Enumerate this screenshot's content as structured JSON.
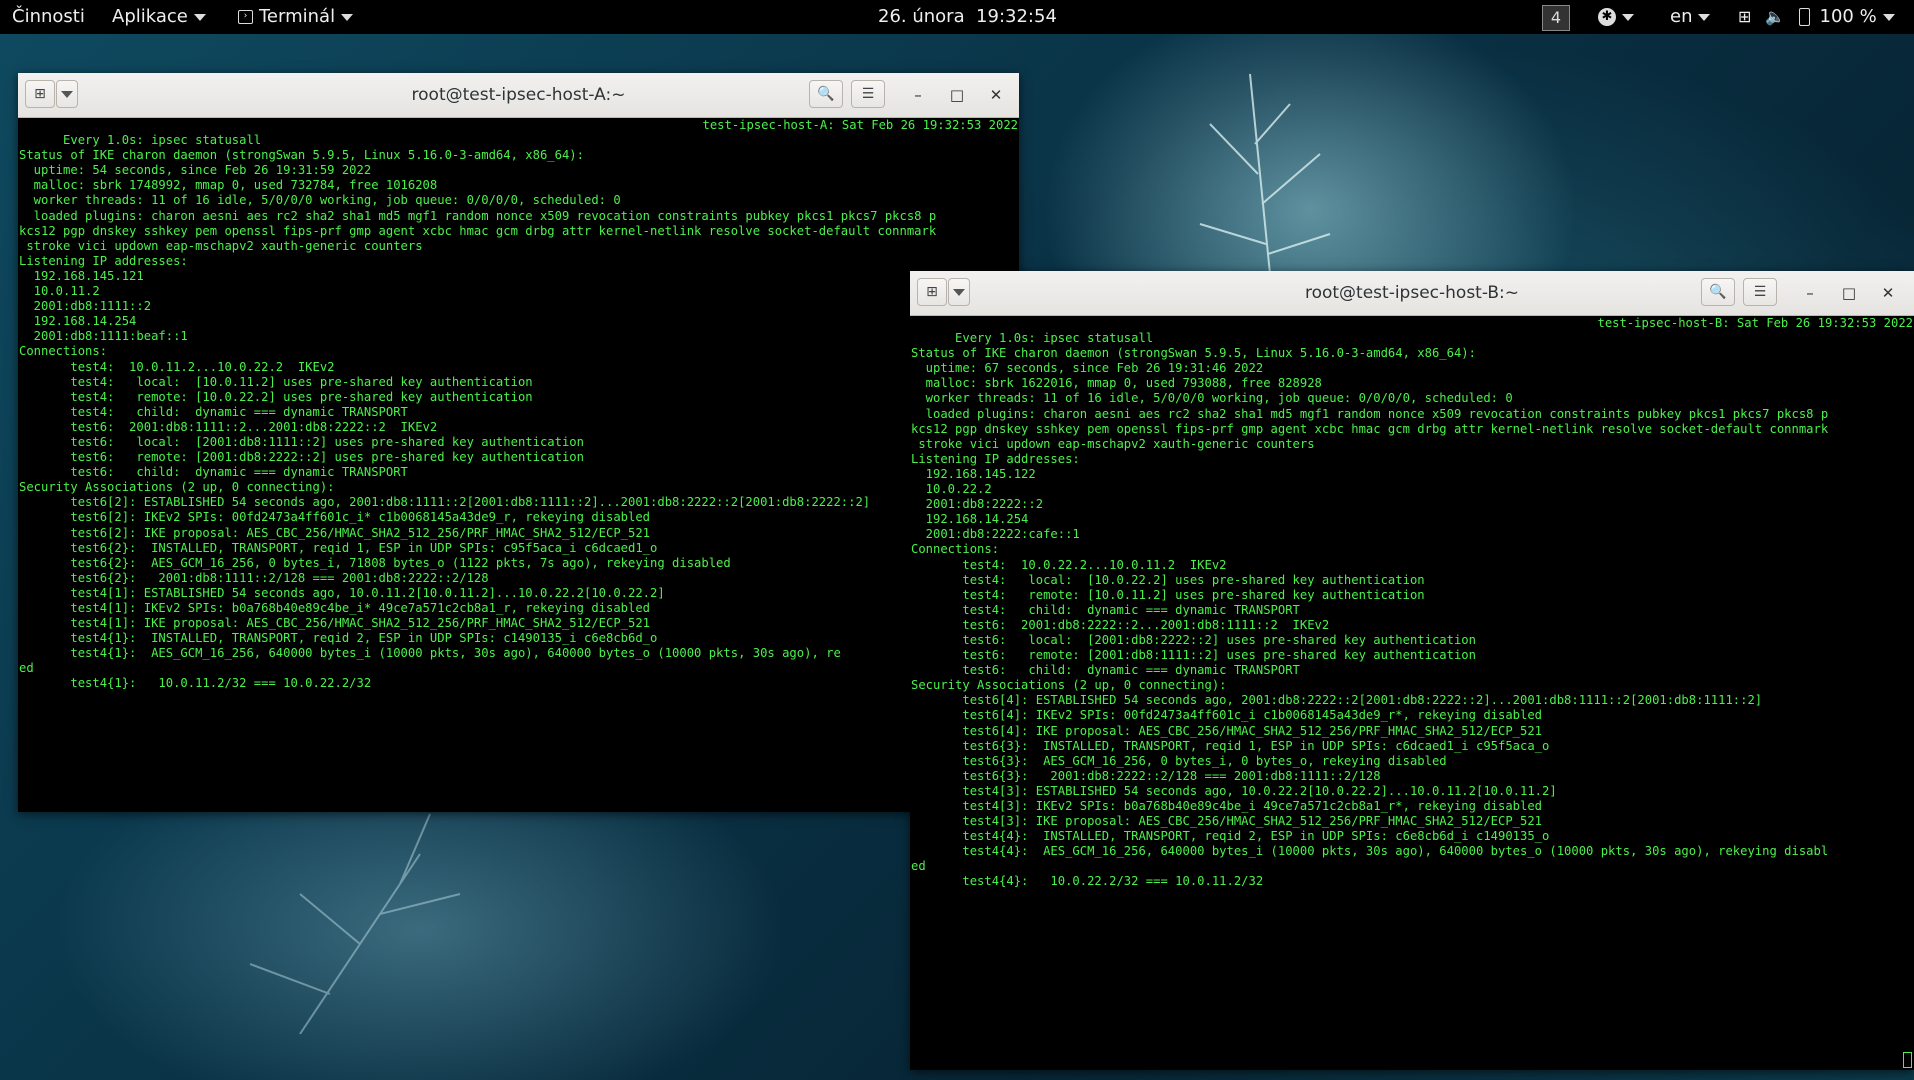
{
  "topbar": {
    "activities": "Činnosti",
    "applications": "Aplikace",
    "app_menu": "Terminál",
    "clock": "26. února  19:32:54",
    "workspace": "4",
    "language": "en",
    "battery": "100 %"
  },
  "colors": {
    "terminal_text": "#4cf04c",
    "terminal_bg": "#000000",
    "titlebar_bg": "#efeeec"
  },
  "window_a": {
    "title": "root@test-ipsec-host-A:~",
    "header_left": "Every 1.0s: ipsec statusall",
    "header_right": "test-ipsec-host-A: Sat Feb 26 19:32:53 2022",
    "lines": [
      "",
      "Status of IKE charon daemon (strongSwan 5.9.5, Linux 5.16.0-3-amd64, x86_64):",
      "  uptime: 54 seconds, since Feb 26 19:31:59 2022",
      "  malloc: sbrk 1748992, mmap 0, used 732784, free 1016208",
      "  worker threads: 11 of 16 idle, 5/0/0/0 working, job queue: 0/0/0/0, scheduled: 0",
      "  loaded plugins: charon aesni aes rc2 sha2 sha1 md5 mgf1 random nonce x509 revocation constraints pubkey pkcs1 pkcs7 pkcs8 p",
      "kcs12 pgp dnskey sshkey pem openssl fips-prf gmp agent xcbc hmac gcm drbg attr kernel-netlink resolve socket-default connmark",
      " stroke vici updown eap-mschapv2 xauth-generic counters",
      "Listening IP addresses:",
      "  192.168.145.121",
      "  10.0.11.2",
      "  2001:db8:1111::2",
      "  192.168.14.254",
      "  2001:db8:1111:beaf::1",
      "Connections:",
      "       test4:  10.0.11.2...10.0.22.2  IKEv2",
      "       test4:   local:  [10.0.11.2] uses pre-shared key authentication",
      "       test4:   remote: [10.0.22.2] uses pre-shared key authentication",
      "       test4:   child:  dynamic === dynamic TRANSPORT",
      "       test6:  2001:db8:1111::2...2001:db8:2222::2  IKEv2",
      "       test6:   local:  [2001:db8:1111::2] uses pre-shared key authentication",
      "       test6:   remote: [2001:db8:2222::2] uses pre-shared key authentication",
      "       test6:   child:  dynamic === dynamic TRANSPORT",
      "Security Associations (2 up, 0 connecting):",
      "       test6[2]: ESTABLISHED 54 seconds ago, 2001:db8:1111::2[2001:db8:1111::2]...2001:db8:2222::2[2001:db8:2222::2]",
      "       test6[2]: IKEv2 SPIs: 00fd2473a4ff601c_i* c1b0068145a43de9_r, rekeying disabled",
      "       test6[2]: IKE proposal: AES_CBC_256/HMAC_SHA2_512_256/PRF_HMAC_SHA2_512/ECP_521",
      "       test6{2}:  INSTALLED, TRANSPORT, reqid 1, ESP in UDP SPIs: c95f5aca_i c6dcaed1_o",
      "       test6{2}:  AES_GCM_16_256, 0 bytes_i, 71808 bytes_o (1122 pkts, 7s ago), rekeying disabled",
      "       test6{2}:   2001:db8:1111::2/128 === 2001:db8:2222::2/128",
      "       test4[1]: ESTABLISHED 54 seconds ago, 10.0.11.2[10.0.11.2]...10.0.22.2[10.0.22.2]",
      "       test4[1]: IKEv2 SPIs: b0a768b40e89c4be_i* 49ce7a571c2cb8a1_r, rekeying disabled",
      "       test4[1]: IKE proposal: AES_CBC_256/HMAC_SHA2_512_256/PRF_HMAC_SHA2_512/ECP_521",
      "       test4{1}:  INSTALLED, TRANSPORT, reqid 2, ESP in UDP SPIs: c1490135_i c6e8cb6d_o",
      "       test4{1}:  AES_GCM_16_256, 640000 bytes_i (10000 pkts, 30s ago), 640000 bytes_o (10000 pkts, 30s ago), re",
      "ed",
      "       test4{1}:   10.0.11.2/32 === 10.0.22.2/32"
    ]
  },
  "window_b": {
    "title": "root@test-ipsec-host-B:~",
    "header_left": "Every 1.0s: ipsec statusall",
    "header_right": "test-ipsec-host-B: Sat Feb 26 19:32:53 2022",
    "lines": [
      "",
      "Status of IKE charon daemon (strongSwan 5.9.5, Linux 5.16.0-3-amd64, x86_64):",
      "  uptime: 67 seconds, since Feb 26 19:31:46 2022",
      "  malloc: sbrk 1622016, mmap 0, used 793088, free 828928",
      "  worker threads: 11 of 16 idle, 5/0/0/0 working, job queue: 0/0/0/0, scheduled: 0",
      "  loaded plugins: charon aesni aes rc2 sha2 sha1 md5 mgf1 random nonce x509 revocation constraints pubkey pkcs1 pkcs7 pkcs8 p",
      "kcs12 pgp dnskey sshkey pem openssl fips-prf gmp agent xcbc hmac gcm drbg attr kernel-netlink resolve socket-default connmark",
      " stroke vici updown eap-mschapv2 xauth-generic counters",
      "Listening IP addresses:",
      "  192.168.145.122",
      "  10.0.22.2",
      "  2001:db8:2222::2",
      "  192.168.14.254",
      "  2001:db8:2222:cafe::1",
      "Connections:",
      "       test4:  10.0.22.2...10.0.11.2  IKEv2",
      "       test4:   local:  [10.0.22.2] uses pre-shared key authentication",
      "       test4:   remote: [10.0.11.2] uses pre-shared key authentication",
      "       test4:   child:  dynamic === dynamic TRANSPORT",
      "       test6:  2001:db8:2222::2...2001:db8:1111::2  IKEv2",
      "       test6:   local:  [2001:db8:2222::2] uses pre-shared key authentication",
      "       test6:   remote: [2001:db8:1111::2] uses pre-shared key authentication",
      "       test6:   child:  dynamic === dynamic TRANSPORT",
      "Security Associations (2 up, 0 connecting):",
      "       test6[4]: ESTABLISHED 54 seconds ago, 2001:db8:2222::2[2001:db8:2222::2]...2001:db8:1111::2[2001:db8:1111::2]",
      "       test6[4]: IKEv2 SPIs: 00fd2473a4ff601c_i c1b0068145a43de9_r*, rekeying disabled",
      "       test6[4]: IKE proposal: AES_CBC_256/HMAC_SHA2_512_256/PRF_HMAC_SHA2_512/ECP_521",
      "       test6{3}:  INSTALLED, TRANSPORT, reqid 1, ESP in UDP SPIs: c6dcaed1_i c95f5aca_o",
      "       test6{3}:  AES_GCM_16_256, 0 bytes_i, 0 bytes_o, rekeying disabled",
      "       test6{3}:   2001:db8:2222::2/128 === 2001:db8:1111::2/128",
      "       test4[3]: ESTABLISHED 54 seconds ago, 10.0.22.2[10.0.22.2]...10.0.11.2[10.0.11.2]",
      "       test4[3]: IKEv2 SPIs: b0a768b40e89c4be_i 49ce7a571c2cb8a1_r*, rekeying disabled",
      "       test4[3]: IKE proposal: AES_CBC_256/HMAC_SHA2_512_256/PRF_HMAC_SHA2_512/ECP_521",
      "       test4{4}:  INSTALLED, TRANSPORT, reqid 2, ESP in UDP SPIs: c6e8cb6d_i c1490135_o",
      "       test4{4}:  AES_GCM_16_256, 640000 bytes_i (10000 pkts, 30s ago), 640000 bytes_o (10000 pkts, 30s ago), rekeying disabl",
      "ed",
      "       test4{4}:   10.0.22.2/32 === 10.0.11.2/32"
    ]
  }
}
